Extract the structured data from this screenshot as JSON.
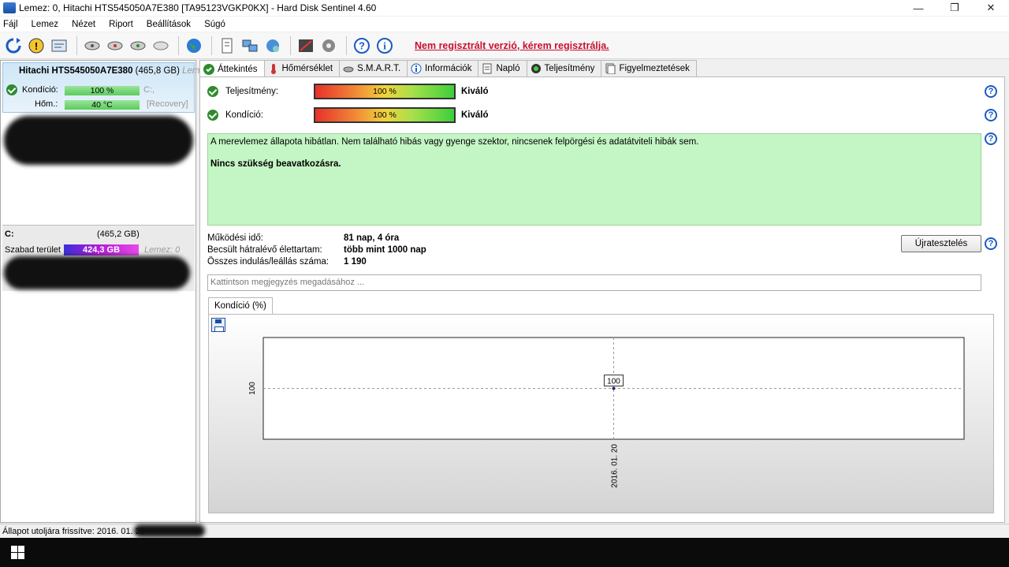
{
  "window": {
    "title": "Lemez: 0, Hitachi HTS545050A7E380 [TA95123VGKP0KX]  -  Hard Disk Sentinel 4.60"
  },
  "menu": [
    "Fájl",
    "Lemez",
    "Nézet",
    "Riport",
    "Beállítások",
    "Súgó"
  ],
  "toolbar": {
    "promo": "Nem regisztrált verzió, kérem regisztrálja."
  },
  "disk": {
    "name": "Hitachi HTS545050A7E380",
    "size": "(465,8 GB)",
    "size_suffix": "Leme",
    "condition_label": "Kondíció:",
    "condition_value": "100 %",
    "condition_level": 100,
    "drive_letter": "C:,",
    "temp_label": "Hőm.:",
    "temp_value": "40 °C",
    "partition_note": "[Recovery]"
  },
  "volume": {
    "letter": "C:",
    "size": "(465,2 GB)",
    "free_label": "Szabad terület",
    "free_value": "424,3 GB",
    "disk_ref": "Lemez: 0"
  },
  "tabs": [
    "Áttekintés",
    "Hőmérséklet",
    "S.M.A.R.T.",
    "Információk",
    "Napló",
    "Teljesítmény",
    "Figyelmeztetések"
  ],
  "overview": {
    "perf_label": "Teljesítmény:",
    "perf_value": "100 %",
    "perf_level": 100,
    "perf_word": "Kiváló",
    "cond_label": "Kondíció:",
    "cond_value": "100 %",
    "cond_level": 100,
    "cond_word": "Kiváló",
    "status_text": "A merevlemez állapota hibátlan. Nem található hibás vagy gyenge szektor, nincsenek felpörgési és adatátviteli hibák sem.",
    "status_bold": "Nincs szükség beavatkozásra.",
    "uptime_label": "Működési idő:",
    "uptime_value": "81 nap, 4 óra",
    "lifetime_label": "Becsült hátralévő élettartam:",
    "lifetime_value": "több mint 1000 nap",
    "starts_label": "Összes indulás/leállás száma:",
    "starts_value": "1 190",
    "reset_button": "Újratesztelés",
    "note_placeholder": "Kattintson megjegyzés megadásához ...",
    "chart_tab": "Kondíció  (%)"
  },
  "chart_data": {
    "type": "line",
    "x": [
      "2016. 01. 20"
    ],
    "series": [
      {
        "values": [
          100
        ]
      }
    ],
    "ylabel_tick": "100",
    "data_label": "100"
  },
  "statusbar": {
    "text": "Állapot utoljára frissítve: 2016. 01. 20"
  },
  "colors": {
    "promo": "#c8102e",
    "status_bg": "#c4f5c4",
    "check": "#2e8b2e",
    "help": "#1a5bc4"
  }
}
